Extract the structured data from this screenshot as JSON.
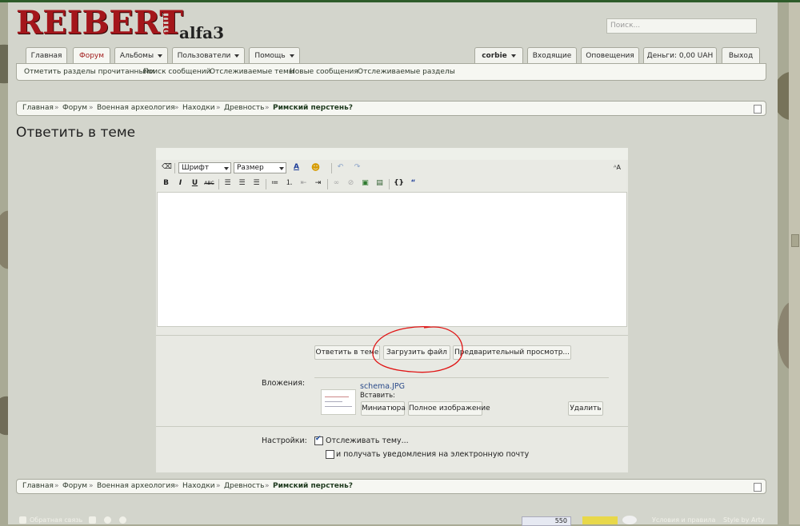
{
  "header": {
    "logo_main": "REIBERT",
    "logo_sup": "info",
    "logo_sub": "alfa3",
    "search_placeholder": "Поиск..."
  },
  "nav": {
    "tabs": [
      "Главная",
      "Форум",
      "Альбомы",
      "Пользователи",
      "Помощь"
    ],
    "user_tabs": [
      "corbie",
      "Входящие",
      "Оповещения",
      "Деньги: 0,00 UAH",
      "Выход"
    ]
  },
  "subnav": [
    "Отметить разделы прочитанными",
    "Поиск сообщений",
    "Отслеживаемые темы",
    "Новые сообщения",
    "Отслеживаемые разделы"
  ],
  "breadcrumb": {
    "items": [
      "Главная",
      "Форум",
      "Военная археология",
      "Находки",
      "Древность"
    ],
    "current": "Римский перстень?",
    "sep": "»"
  },
  "page_title": "Ответить в теме",
  "editor": {
    "font_label": "Шрифт",
    "size_label": "Размер"
  },
  "buttons": {
    "reply": "Ответить в теме",
    "upload": "Загрузить файл",
    "preview": "Предварительный просмотр..."
  },
  "attachments": {
    "label": "Вложения:",
    "filename": "schema.JPG",
    "insert_label": "Вставить:",
    "thumb_btn": "Миниатюра",
    "full_btn": "Полное изображение",
    "delete_btn": "Удалить"
  },
  "settings": {
    "label": "Настройки:",
    "watch": "Отслеживать тему...",
    "email": "и получать уведомления на электронную почту",
    "watch_checked": true,
    "email_checked": false
  },
  "footer": {
    "feedback": "Обратная связь",
    "counter": "550",
    "rules": "Условия и правила",
    "style": "Style by Arty"
  },
  "colors": {
    "logo_red": "#a4161b",
    "annotation_red": "#e01515",
    "active_tab": "#a11b1b"
  }
}
